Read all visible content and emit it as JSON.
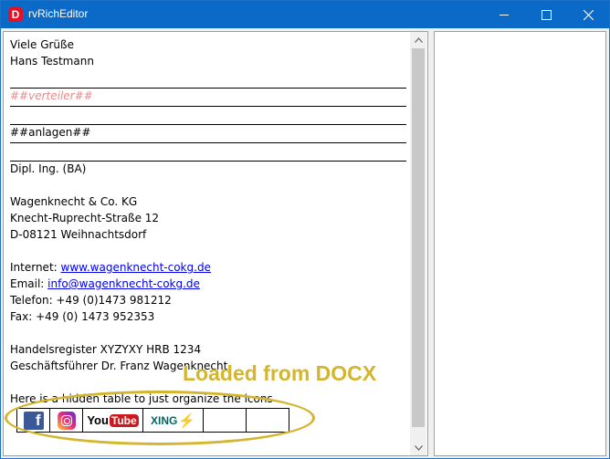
{
  "window": {
    "app_icon_letter": "D",
    "title": "rvRichEditor"
  },
  "editor": {
    "lines": {
      "greeting": "Viele Grüße",
      "name": "Hans Testmann",
      "verteiler": "##verteiler##",
      "anlagen": "##anlagen##",
      "degree": "Dipl. Ing. (BA)",
      "company": "Wagenknecht & Co. KG",
      "street": "Knecht-Ruprecht-Straße 12",
      "city": "D-08121 Weihnachtsdorf",
      "internet_label": "Internet: ",
      "internet_link": "www.wagenknecht-cokg.de",
      "email_label": "Email: ",
      "email_link": "info@wagenknecht-cokg.de",
      "phone": "Telefon: +49 (0)1473 981212",
      "fax": "Fax: +49 (0) 1473 952353",
      "register": "Handelsregister XYZYXY HRB 1234",
      "manager": "Geschäftsführer Dr. Franz Wagenknecht",
      "hidden_table_note": "Here is a hidden table to just organize the icons"
    },
    "social_icons": [
      "facebook-icon",
      "instagram-icon",
      "youtube-icon",
      "xing-icon"
    ],
    "youtube_text": {
      "you": "You",
      "tube": "Tube"
    },
    "xing_text": "XING",
    "facebook_letter": "f",
    "placeholder_color": "#e88a8a",
    "link_color": "#0000ee"
  },
  "annotation": {
    "label": "Loaded from DOCX",
    "color": "#d4b52e"
  },
  "colors": {
    "titlebar": "#0b6ac8"
  }
}
